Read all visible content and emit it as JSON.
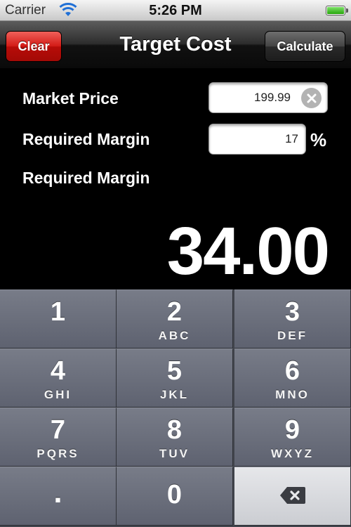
{
  "status_bar": {
    "carrier": "Carrier",
    "time": "5:26 PM",
    "wifi_icon": "wifi-icon",
    "battery_icon": "battery-icon"
  },
  "nav": {
    "title": "Target Cost",
    "clear_label": "Clear",
    "calculate_label": "Calculate",
    "clear_color": "#d21a15"
  },
  "form": {
    "market_price_label": "Market Price",
    "market_price_value": "199.99",
    "required_margin_label": "Required Margin",
    "required_margin_value": "17",
    "percent_symbol": "%",
    "result_label": "Required Margin",
    "result_value": "34.00"
  },
  "keypad": {
    "keys": [
      {
        "num": "1",
        "letters": ""
      },
      {
        "num": "2",
        "letters": "ABC"
      },
      {
        "num": "3",
        "letters": "DEF"
      },
      {
        "num": "4",
        "letters": "GHI"
      },
      {
        "num": "5",
        "letters": "JKL"
      },
      {
        "num": "6",
        "letters": "MNO"
      },
      {
        "num": "7",
        "letters": "PQRS"
      },
      {
        "num": "8",
        "letters": "TUV"
      },
      {
        "num": "9",
        "letters": "WXYZ"
      },
      {
        "num": ".",
        "letters": ""
      },
      {
        "num": "0",
        "letters": ""
      }
    ],
    "delete_icon": "backspace-icon"
  }
}
